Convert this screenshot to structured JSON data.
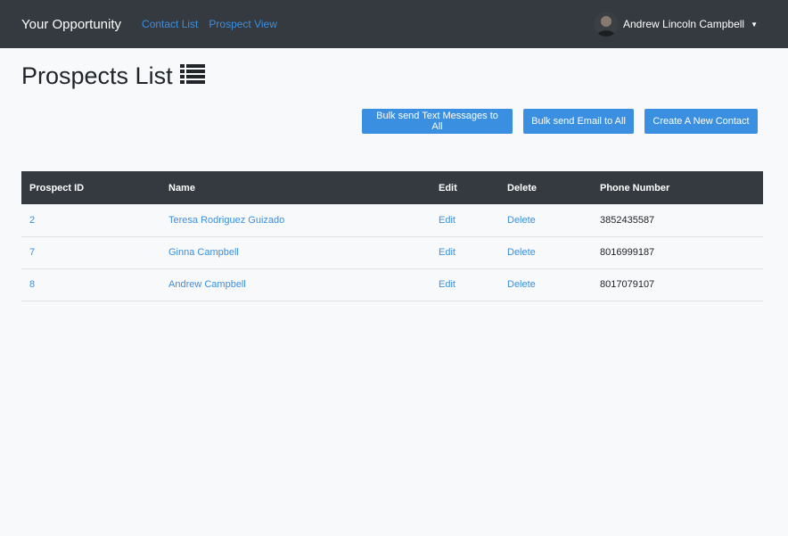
{
  "navbar": {
    "brand": "Your Opportunity",
    "links": [
      "Contact List",
      "Prospect View"
    ],
    "user_name": "Andrew Lincoln Campbell"
  },
  "page": {
    "title": "Prospects List",
    "title_icon": "list-icon"
  },
  "actions": {
    "bulk_text": "Bulk send Text Messages to All",
    "bulk_email": "Bulk send Email to All",
    "create_contact": "Create A New Contact"
  },
  "table": {
    "headers": [
      "Prospect ID",
      "Name",
      "Edit",
      "Delete",
      "Phone Number"
    ],
    "rows": [
      {
        "id": "2",
        "name": "Teresa Rodriguez Guizado",
        "edit": "Edit",
        "delete": "Delete",
        "phone": "3852435587"
      },
      {
        "id": "7",
        "name": "Ginna Campbell",
        "edit": "Edit",
        "delete": "Delete",
        "phone": "8016999187"
      },
      {
        "id": "8",
        "name": "Andrew Campbell",
        "edit": "Edit",
        "delete": "Delete",
        "phone": "8017079107"
      }
    ]
  },
  "colors": {
    "navbar": "#343a40",
    "accent": "#3b8fe0",
    "background": "#f7f9fb"
  }
}
